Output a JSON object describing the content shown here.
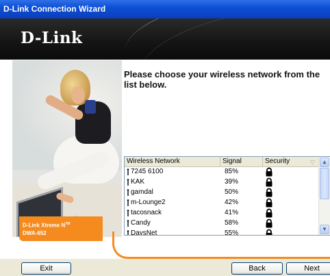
{
  "window": {
    "title": "D-Link Connection Wizard"
  },
  "banner": {
    "logo_text": "D-Link",
    "bg_color": "#141414"
  },
  "product": {
    "line1": "D-Link Xtreme N",
    "tm": "TM",
    "line2": "DWA-652",
    "badge_color": "#f58b1f"
  },
  "instruction": "Please choose your wireless network from the list below.",
  "network_list": {
    "columns": [
      "Wireless Network",
      "Signal",
      "Security"
    ],
    "rows": [
      {
        "name": "7245 6100",
        "signal": "85%",
        "security": "lock-icon"
      },
      {
        "name": "KAK",
        "signal": "39%",
        "security": "lock-icon"
      },
      {
        "name": "gamdal",
        "signal": "50%",
        "security": "lock-icon"
      },
      {
        "name": "m-Lounge2",
        "signal": "42%",
        "security": "lock-icon"
      },
      {
        "name": "tacosnack",
        "signal": "41%",
        "security": "lock-icon"
      },
      {
        "name": "Candy",
        "signal": "58%",
        "security": "lock-icon"
      },
      {
        "name": "DaysNet",
        "signal": "55%",
        "security": "lock-icon"
      }
    ]
  },
  "buttons": {
    "exit": "Exit",
    "back": "Back",
    "next": "Next"
  }
}
